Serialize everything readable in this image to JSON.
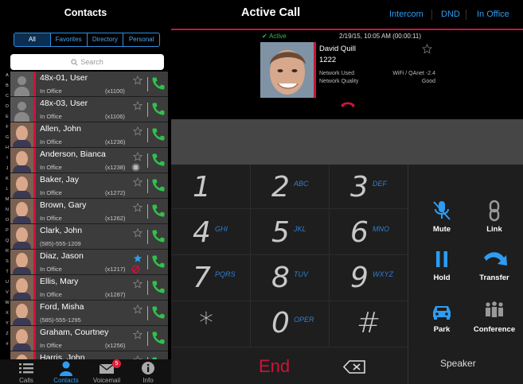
{
  "contacts_panel": {
    "title": "Contacts",
    "filters": [
      "All",
      "Favorites",
      "Directory",
      "Personal"
    ],
    "search_placeholder": "Search",
    "alphabet": [
      "A",
      "B",
      "C",
      "D",
      "E",
      "F",
      "G",
      "H",
      "I",
      "J",
      "K",
      "L",
      "M",
      "N",
      "O",
      "P",
      "Q",
      "R",
      "S",
      "T",
      "U",
      "V",
      "W",
      "X",
      "Y",
      "Z",
      "#"
    ],
    "contacts": [
      {
        "name": "48x-01, User",
        "status": "In Office",
        "ext": "(x1100)",
        "photo": false,
        "favorite": false
      },
      {
        "name": "48x-03, User",
        "status": "In Office",
        "ext": "(x1106)",
        "photo": false,
        "favorite": false
      },
      {
        "name": "Allen, John",
        "status": "In Office",
        "ext": "(x1236)",
        "photo": true,
        "favorite": false
      },
      {
        "name": "Anderson, Bianca",
        "status": "In Office",
        "ext": "(x1238)",
        "photo": true,
        "favorite": false,
        "presence": "busy"
      },
      {
        "name": "Baker, Jay",
        "status": "In Office",
        "ext": "(x1272)",
        "photo": true,
        "favorite": false
      },
      {
        "name": "Brown, Gary",
        "status": "In Office",
        "ext": "(x1262)",
        "photo": true,
        "favorite": false
      },
      {
        "name": "Clark, John",
        "status": "(585)-555-1209",
        "ext": "",
        "photo": true,
        "favorite": false
      },
      {
        "name": "Diaz, Jason",
        "status": "In Office",
        "ext": "(x1217)",
        "photo": true,
        "favorite": true,
        "presence": "forward"
      },
      {
        "name": "Ellis, Mary",
        "status": "In Office",
        "ext": "(x1287)",
        "photo": true,
        "favorite": false
      },
      {
        "name": "Ford, Misha",
        "status": "(585)-555-1295",
        "ext": "",
        "photo": true,
        "favorite": false
      },
      {
        "name": "Graham, Courtney",
        "status": "In Office",
        "ext": "(x1256)",
        "photo": true,
        "favorite": false
      },
      {
        "name": "Harris, John",
        "status": "",
        "ext": "",
        "photo": true,
        "favorite": false
      }
    ],
    "tabs": [
      {
        "label": "Calls",
        "icon": "list-icon"
      },
      {
        "label": "Contacts",
        "icon": "person-icon",
        "active": true
      },
      {
        "label": "Voicemail",
        "icon": "envelope-icon",
        "badge": "5"
      },
      {
        "label": "Info",
        "icon": "info-icon"
      }
    ]
  },
  "header": {
    "title": "Active Call",
    "links": [
      "Intercom",
      "DND",
      "In Office"
    ]
  },
  "call": {
    "state": "Active",
    "timestamp": "2/19/15, 10:05 AM (00:00:11)",
    "caller_name": "David Quill",
    "caller_ext": "1222",
    "network_used_label": "Network Used",
    "network_used_value": "WiFi / QAnet -2.4",
    "network_quality_label": "Network Quality",
    "network_quality_value": "Good"
  },
  "keypad": {
    "keys": [
      {
        "digit": "1",
        "letters": ""
      },
      {
        "digit": "2",
        "letters": "ABC"
      },
      {
        "digit": "3",
        "letters": "DEF"
      },
      {
        "digit": "4",
        "letters": "GHI"
      },
      {
        "digit": "5",
        "letters": "JKL"
      },
      {
        "digit": "6",
        "letters": "MNO"
      },
      {
        "digit": "7",
        "letters": "PQRS"
      },
      {
        "digit": "8",
        "letters": "TUV"
      },
      {
        "digit": "9",
        "letters": "WXYZ"
      },
      {
        "digit": "*",
        "letters": ""
      },
      {
        "digit": "0",
        "letters": "OPER"
      },
      {
        "digit": "#",
        "letters": ""
      }
    ],
    "end_label": "End"
  },
  "actions": {
    "mute": "Mute",
    "link": "Link",
    "hold": "Hold",
    "transfer": "Transfer",
    "park": "Park",
    "conference": "Conference",
    "speaker": "Speaker"
  },
  "colors": {
    "accent": "#c6163c",
    "link_blue": "#2e9cf2",
    "active_green": "#35b552",
    "call_green": "#2fc24a"
  }
}
